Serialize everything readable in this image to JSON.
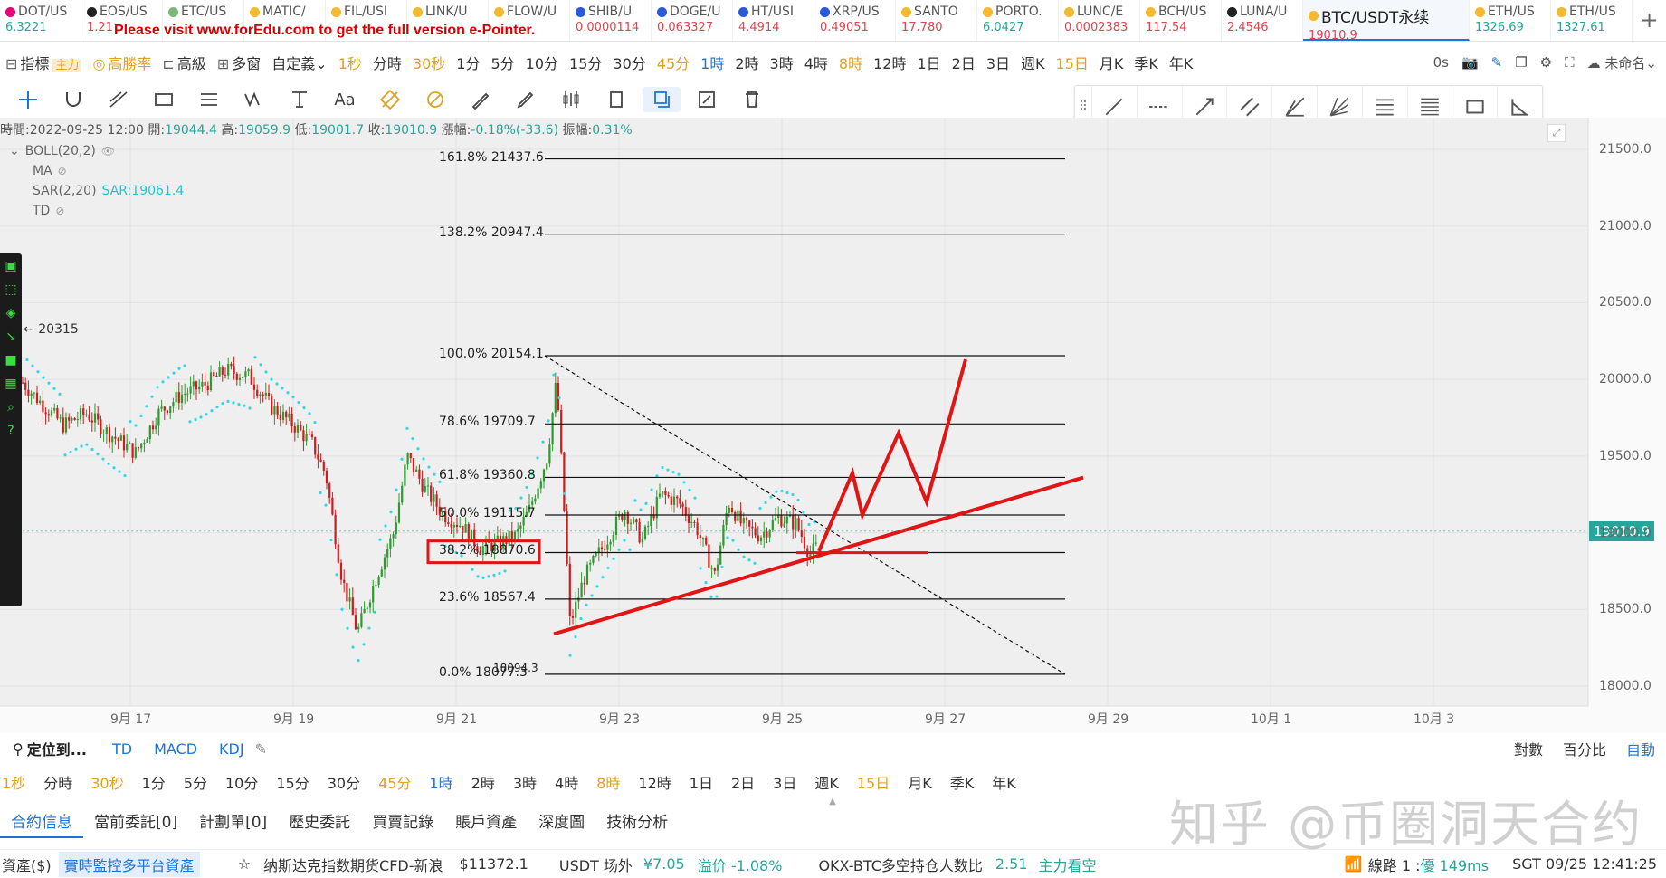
{
  "promo": "Please visit www.forEdu.com to get the full version e-Pointer.",
  "ticker": [
    {
      "sym": "DOT/US",
      "price": "6.3221",
      "dir": "up",
      "icon": "coin-icon",
      "color": "#e6007a"
    },
    {
      "sym": "EOS/US",
      "price": "1.21",
      "dir": "down",
      "icon": "eos-icon",
      "color": "#222222"
    },
    {
      "sym": "ETC/US",
      "price": "",
      "dir": "down",
      "icon": "etc-icon",
      "color": "#7ab87a"
    },
    {
      "sym": "MATIC/",
      "price": "",
      "dir": "down",
      "icon": "matic-icon",
      "color": "#f3ba2f"
    },
    {
      "sym": "FIL/USI",
      "price": "",
      "dir": "down",
      "icon": "fil-icon",
      "color": "#f3ba2f"
    },
    {
      "sym": "LINK/U",
      "price": "",
      "dir": "down",
      "icon": "link-icon",
      "color": "#f3ba2f"
    },
    {
      "sym": "FLOW/U",
      "price": "",
      "dir": "down",
      "icon": "flow-icon",
      "color": "#f3ba2f"
    },
    {
      "sym": "SHIB/U",
      "price": "0.0000114",
      "dir": "down",
      "icon": "shib-icon",
      "color": "#2a5ada"
    },
    {
      "sym": "DOGE/U",
      "price": "0.063327",
      "dir": "down",
      "icon": "doge-icon",
      "color": "#2a5ada"
    },
    {
      "sym": "HT/USI",
      "price": "4.4914",
      "dir": "down",
      "icon": "ht-icon",
      "color": "#2a5ada"
    },
    {
      "sym": "XRP/US",
      "price": "0.49051",
      "dir": "down",
      "icon": "xrp-icon",
      "color": "#2a5ada"
    },
    {
      "sym": "SANTO",
      "price": "17.780",
      "dir": "down",
      "icon": "santo-icon",
      "color": "#f3ba2f"
    },
    {
      "sym": "PORTO.",
      "price": "6.0427",
      "dir": "up",
      "icon": "porto-icon",
      "color": "#f3ba2f"
    },
    {
      "sym": "LUNC/E",
      "price": "0.0002383",
      "dir": "down",
      "icon": "lunc-icon",
      "color": "#f3ba2f"
    },
    {
      "sym": "BCH/US",
      "price": "117.54",
      "dir": "down",
      "icon": "bch-icon",
      "color": "#f3ba2f"
    },
    {
      "sym": "LUNA/U",
      "price": "2.4546",
      "dir": "down",
      "icon": "luna-icon",
      "color": "#222222"
    },
    {
      "sym": "BTC/USDT永续",
      "price": "19010.9",
      "dir": "down",
      "icon": "btc-icon",
      "color": "#f3ba2f",
      "active": true
    },
    {
      "sym": "ETH/US",
      "price": "1326.69",
      "dir": "up",
      "icon": "eth-icon",
      "color": "#f3ba2f"
    },
    {
      "sym": "ETH/US",
      "price": "1327.61",
      "dir": "up",
      "icon": "eth-icon",
      "color": "#f3ba2f"
    }
  ],
  "toolbar": {
    "indicator": "指標",
    "main_tag": "主力",
    "winrate": "高勝率",
    "advanced": "高級",
    "multi": "多窗",
    "custom": "自定義",
    "intervals": [
      {
        "label": "1秒",
        "style": "hl"
      },
      {
        "label": "分時",
        "style": ""
      },
      {
        "label": "30秒",
        "style": "hl"
      },
      {
        "label": "1分",
        "style": ""
      },
      {
        "label": "5分",
        "style": ""
      },
      {
        "label": "10分",
        "style": ""
      },
      {
        "label": "15分",
        "style": ""
      },
      {
        "label": "30分",
        "style": ""
      },
      {
        "label": "45分",
        "style": "hl"
      },
      {
        "label": "1時",
        "style": "sel"
      },
      {
        "label": "2時",
        "style": ""
      },
      {
        "label": "3時",
        "style": ""
      },
      {
        "label": "4時",
        "style": ""
      },
      {
        "label": "8時",
        "style": "hl"
      },
      {
        "label": "12時",
        "style": ""
      },
      {
        "label": "1日",
        "style": ""
      },
      {
        "label": "2日",
        "style": ""
      },
      {
        "label": "3日",
        "style": ""
      },
      {
        "label": "週K",
        "style": ""
      },
      {
        "label": "15日",
        "style": "hl"
      },
      {
        "label": "月K",
        "style": ""
      },
      {
        "label": "季K",
        "style": ""
      },
      {
        "label": "年K",
        "style": ""
      }
    ],
    "countdown": "0s",
    "account": "未命名"
  },
  "ohlc": {
    "time_label": "時間:",
    "time": "2022-09-25 12:00",
    "open_label": "開:",
    "open": "19044.4",
    "high_label": "高:",
    "high": "19059.9",
    "low_label": "低:",
    "low": "19001.7",
    "close_label": "收:",
    "close": "19010.9",
    "chg_label": "漲幅:",
    "chg": "-0.18%(-33.6)",
    "amp_label": "振幅:",
    "amp": "0.31%"
  },
  "indicators": {
    "boll": "BOLL(20,2)",
    "ma": "MA",
    "sar": "SAR(2,20)",
    "sar_value": "SAR:19061.4",
    "td": "TD"
  },
  "chart_data": {
    "type": "candlestick",
    "symbol": "BTC/USDT永续",
    "interval": "1時",
    "current_price": 19010.9,
    "high_marker": "20315",
    "y_axis": {
      "min": 17900,
      "max": 21600,
      "ticks": [
        "21500.0",
        "21000.0",
        "20500.0",
        "20000.0",
        "19500.0",
        "19000.0",
        "18500.0",
        "18000.0"
      ]
    },
    "x_axis": {
      "ticks": [
        "9月 17",
        "9月 19",
        "9月 21",
        "9月 23",
        "9月 25",
        "9月 27",
        "9月 29",
        "10月 1",
        "10月 3"
      ]
    },
    "fibonacci": [
      {
        "label": "161.8% 21437.6",
        "price": 21437.6
      },
      {
        "label": "138.2% 20947.4",
        "price": 20947.4
      },
      {
        "label": "100.0% 20154.1",
        "price": 20154.1
      },
      {
        "label": "78.6% 19709.7",
        "price": 19709.7
      },
      {
        "label": "61.8% 19360.8",
        "price": 19360.8
      },
      {
        "label": "50.0% 19115.7",
        "price": 19115.7
      },
      {
        "label": "38.2% 18870.6",
        "price": 18870.6
      },
      {
        "label": "23.6% 18567.4",
        "price": 18567.4
      },
      {
        "label": "0.0% 18077.3",
        "price": 18077.3
      }
    ],
    "low_marker": "18094.3",
    "annotations": [
      "red rising support trendline",
      "red zigzag projection upward",
      "dashed descending trendline from 20154.1",
      "red box on 38.2% level"
    ]
  },
  "bottom": {
    "locate": "定位到...",
    "ind_tabs": [
      "TD",
      "MACD",
      "KDJ"
    ],
    "scale_opts": [
      {
        "label": "對數",
        "sel": false
      },
      {
        "label": "百分比",
        "sel": false
      },
      {
        "label": "自動",
        "sel": true
      }
    ],
    "intervals": [
      {
        "label": "1秒",
        "style": "hl"
      },
      {
        "label": "分時",
        "style": ""
      },
      {
        "label": "30秒",
        "style": "hl"
      },
      {
        "label": "1分",
        "style": ""
      },
      {
        "label": "5分",
        "style": ""
      },
      {
        "label": "10分",
        "style": ""
      },
      {
        "label": "15分",
        "style": ""
      },
      {
        "label": "30分",
        "style": ""
      },
      {
        "label": "45分",
        "style": "hl"
      },
      {
        "label": "1時",
        "style": "sel"
      },
      {
        "label": "2時",
        "style": ""
      },
      {
        "label": "3時",
        "style": ""
      },
      {
        "label": "4時",
        "style": ""
      },
      {
        "label": "8時",
        "style": "hl"
      },
      {
        "label": "12時",
        "style": ""
      },
      {
        "label": "1日",
        "style": ""
      },
      {
        "label": "2日",
        "style": ""
      },
      {
        "label": "3日",
        "style": ""
      },
      {
        "label": "週K",
        "style": ""
      },
      {
        "label": "15日",
        "style": "hl"
      },
      {
        "label": "月K",
        "style": ""
      },
      {
        "label": "季K",
        "style": ""
      },
      {
        "label": "年K",
        "style": ""
      }
    ],
    "tabs": [
      {
        "label": "合約信息",
        "sel": true
      },
      {
        "label": "當前委託[0]",
        "sel": false
      },
      {
        "label": "計劃單[0]",
        "sel": false
      },
      {
        "label": "歷史委託",
        "sel": false
      },
      {
        "label": "買賣記錄",
        "sel": false
      },
      {
        "label": "賬戶資產",
        "sel": false
      },
      {
        "label": "深度圖",
        "sel": false
      },
      {
        "label": "技術分析",
        "sel": false
      }
    ]
  },
  "status": {
    "assets": "資產($)",
    "monitor": "實時監控多平台資產",
    "nasdaq": "纳斯达克指数期货CFD-新浪",
    "nasdaq_val": "$11372.1",
    "usdt": "USDT 场外",
    "usdt_val": "¥7.05",
    "premium": "溢价 -1.08%",
    "okx": "OKX-BTC多空持仓人数比",
    "okx_val": "2.51",
    "okx_view": "主力看空",
    "line": "線路 1 : ",
    "line_q": "優 149ms",
    "clock": "SGT  09/25 12:41:25"
  },
  "watermark": "知乎 @币圈洞天合约"
}
